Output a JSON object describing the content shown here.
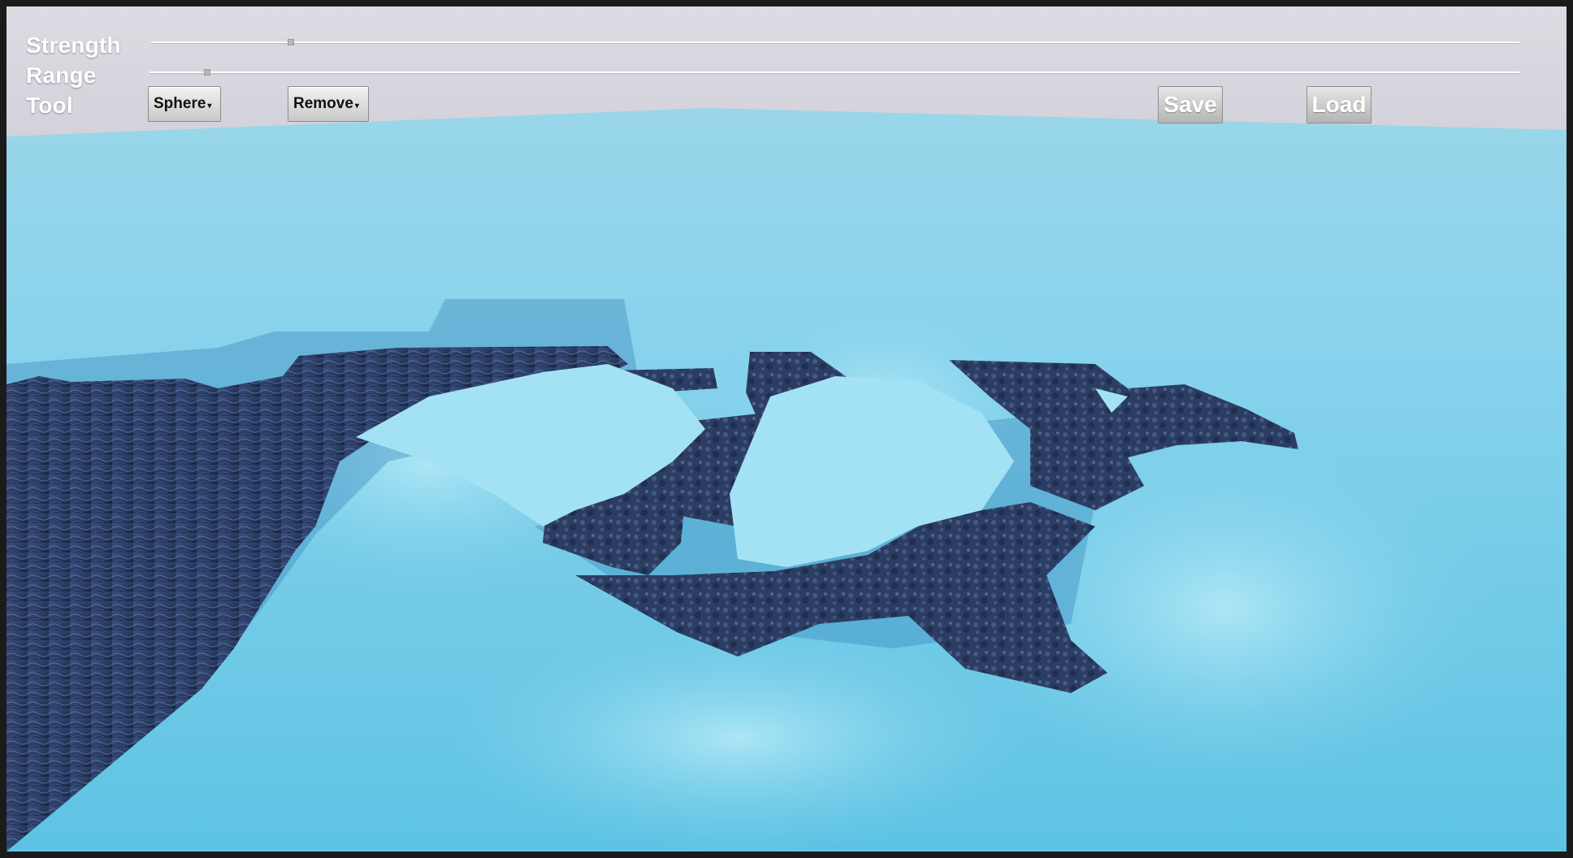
{
  "hud": {
    "strength_label": "Strength",
    "range_label": "Range",
    "tool_label": "Tool",
    "strength_value": 0.1,
    "range_value": 0.04,
    "shape_dropdown": "Sphere",
    "mode_dropdown": "Remove",
    "save_label": "Save",
    "load_label": "Load"
  },
  "colors": {
    "sky": "#d9d6de",
    "terrain_light": "#8fd6ec",
    "terrain_mid": "#63c4e4",
    "water_dark": "#2a3d66",
    "water_deep": "#1b2a4a"
  }
}
